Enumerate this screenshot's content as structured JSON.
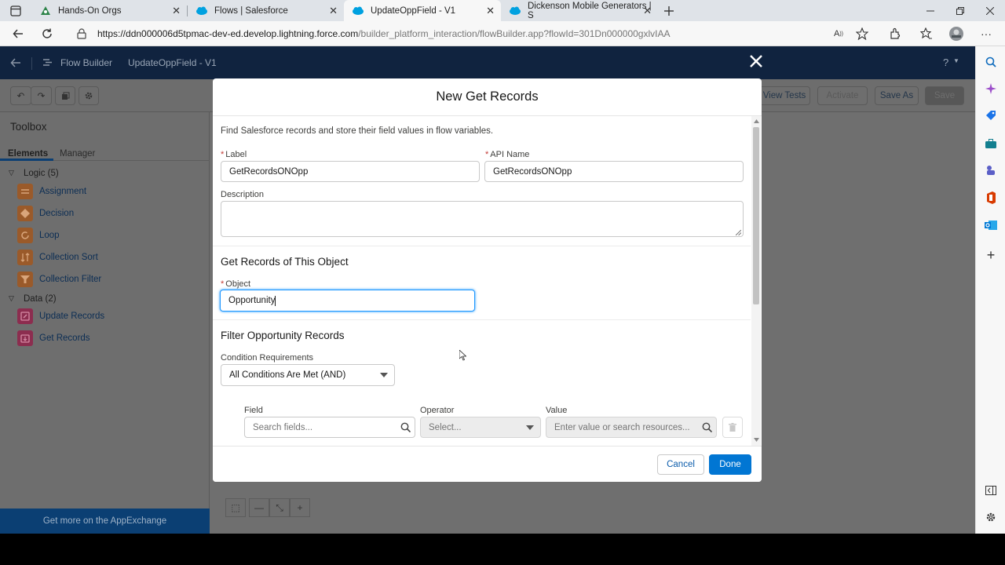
{
  "browser": {
    "tabs": [
      {
        "title": "Hands-On Orgs",
        "active": false
      },
      {
        "title": "Flows | Salesforce",
        "active": false
      },
      {
        "title": "UpdateOppField - V1",
        "active": true
      },
      {
        "title": "Dickenson Mobile Generators | S",
        "active": false
      }
    ],
    "url_host": "https://ddn000006d5tpmac-dev-ed.develop.lightning.force.com",
    "url_path": "/builder_platform_interaction/flowBuilder.app?flowId=301Dn000000gxlvIAA"
  },
  "app": {
    "header_title": "Flow Builder",
    "flow_name": "UpdateOppField - V1",
    "help_label": "?",
    "toolbar": {
      "view_tests": "View Tests",
      "activate": "Activate",
      "save_as": "Save As",
      "save": "Save"
    },
    "toolbox": {
      "title": "Toolbox",
      "tab_elements": "Elements",
      "tab_manager": "Manager",
      "logic_group": "Logic (5)",
      "logic_items": [
        "Assignment",
        "Decision",
        "Loop",
        "Collection Sort",
        "Collection Filter"
      ],
      "data_group": "Data (2)",
      "data_items": [
        "Update Records",
        "Get Records"
      ],
      "appexchange": "Get more on the AppExchange"
    }
  },
  "modal": {
    "title": "New Get Records",
    "intro": "Find Salesforce records and store their field values in flow variables.",
    "label_label": "Label",
    "label_value": "GetRecordsONOpp",
    "api_label": "API Name",
    "api_value": "GetRecordsONOpp",
    "description_label": "Description",
    "section_object": "Get Records of This Object",
    "object_label": "Object",
    "object_value": "Opportunity",
    "section_filter": "Filter Opportunity Records",
    "condition_label": "Condition Requirements",
    "condition_value": "All Conditions Are Met (AND)",
    "field_label": "Field",
    "field_placeholder": "Search fields...",
    "operator_label": "Operator",
    "operator_placeholder": "Select...",
    "value_label": "Value",
    "value_placeholder": "Enter value or search resources...",
    "cancel": "Cancel",
    "done": "Done"
  },
  "colors": {
    "brand_blue": "#0176d3",
    "header_navy": "#10233f",
    "required_red": "#c23934",
    "focus_blue": "#1b96ff"
  }
}
